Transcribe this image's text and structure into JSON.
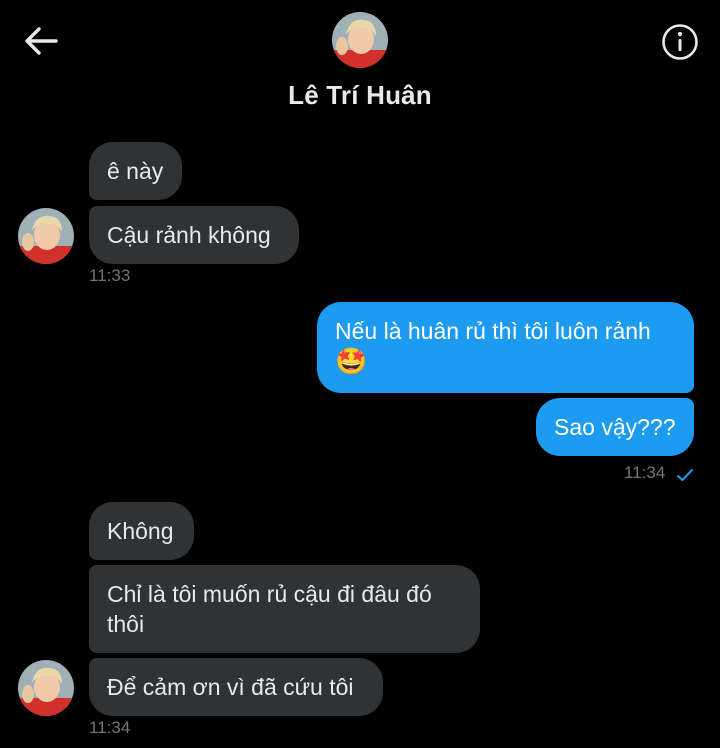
{
  "header": {
    "title": "Lê Trí Huân",
    "back_icon": "arrow-left-icon",
    "info_icon": "info-icon"
  },
  "messages": [
    {
      "side": "in",
      "text": "ê này"
    },
    {
      "side": "in",
      "text": "Cậu rảnh không"
    },
    {
      "side": "in_time",
      "text": "11:33"
    },
    {
      "side": "out",
      "text": "Nếu là huân rủ thì tôi luôn rảnh",
      "emoji": "🤩"
    },
    {
      "side": "out",
      "text": "Sao vậy???"
    },
    {
      "side": "out_time",
      "text": "11:34",
      "status_icon": "check-icon"
    },
    {
      "side": "in",
      "text": "Không"
    },
    {
      "side": "in",
      "text_line1": "Chỉ là tôi muốn rủ cậu đi đâu đó",
      "text_line2": "thôi"
    },
    {
      "side": "in",
      "text": "Để cảm ơn vì đã cứu tôi"
    },
    {
      "side": "in_time",
      "text": "11:34"
    }
  ],
  "colors": {
    "background": "#000000",
    "incoming_bubble": "#2f3336",
    "outgoing_bubble": "#1d9bf0",
    "timestamp": "#71767b",
    "check": "#1d9bf0"
  }
}
